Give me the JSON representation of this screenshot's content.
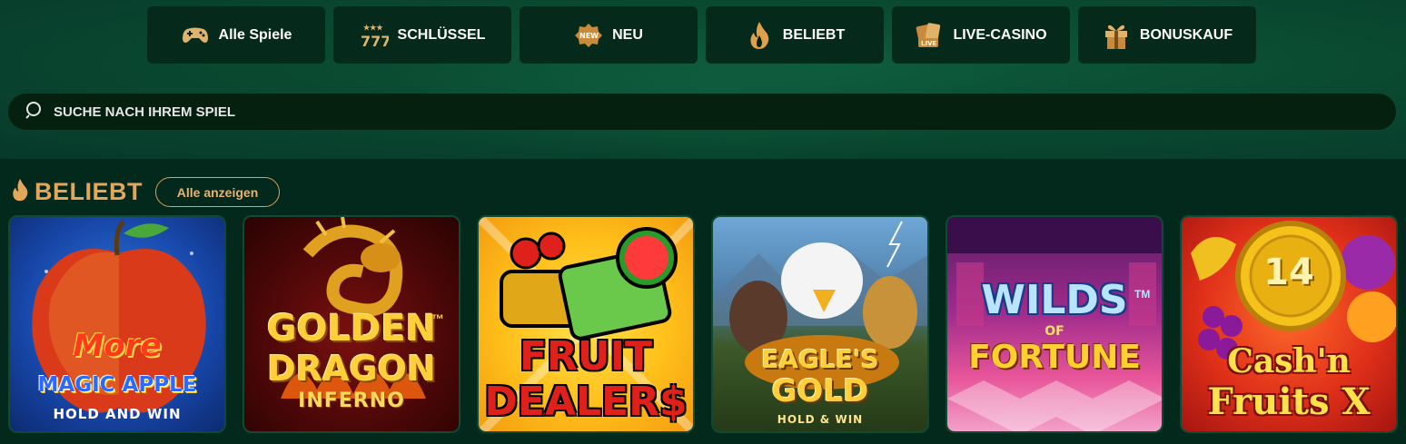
{
  "nav": {
    "tabs": [
      {
        "label": "Alle Spiele",
        "icon": "gamepad-icon"
      },
      {
        "label": "SCHLÜSSEL",
        "icon": "777-icon"
      },
      {
        "label": "NEU",
        "icon": "new-badge-icon"
      },
      {
        "label": "BELIEBT",
        "icon": "flame-icon"
      },
      {
        "label": "LIVE-CASINO",
        "icon": "live-cards-icon"
      },
      {
        "label": "BONUSKAUF",
        "icon": "gift-icon"
      }
    ]
  },
  "search": {
    "placeholder": "SUCHE NACH IHREM SPIEL",
    "icon": "search-icon"
  },
  "section": {
    "title": "BELIEBT",
    "show_all_label": "Alle anzeigen",
    "icon": "flame-icon"
  },
  "games": [
    {
      "line1": "More",
      "line2": "MAGIC APPLE",
      "line3": "HOLD AND WIN"
    },
    {
      "line1": "GOLDEN",
      "line2": "DRAGON",
      "line3": "INFERNO",
      "tm": "™"
    },
    {
      "line1": "FRUIT",
      "line2": "DEALER$"
    },
    {
      "line1": "EAGLE'S",
      "line2": "GOLD",
      "line3": "HOLD & WIN"
    },
    {
      "line1": "WILDS",
      "line2": "OF",
      "line3": "FORTUNE",
      "tm": "TM"
    },
    {
      "line1": "Cash'n",
      "line2": "Fruits X",
      "coin": "14"
    }
  ],
  "colors": {
    "accent": "#e3a65a",
    "background": "#03291c",
    "tab_bg": "#052a1c"
  }
}
